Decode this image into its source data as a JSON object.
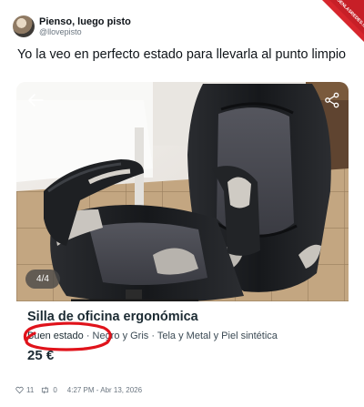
{
  "tweet": {
    "display_name": "Pienso, luego pisto",
    "handle": "@llovepisto",
    "text": "Yo la veo en perfecto estado para llevarla al punto limpio"
  },
  "listing": {
    "image_counter": "4/4",
    "title": "Silla de oficina ergonómica",
    "condition": "Buen estado",
    "attributes": " · Negro y Gris · Tela y Metal y Piel sintética",
    "price": "25 €"
  },
  "footer": {
    "likes": "11",
    "retweets": "0",
    "timestamp": "4:27 PM - Abr 13, 2026"
  },
  "watermark": {
    "text": "VISTOENLASREDES.COM"
  },
  "colors": {
    "annotation_red": "#e0131b",
    "chair_black": "#1d1f22",
    "fabric_gray": "#4a4b52",
    "floor_tile": "#b89a76"
  },
  "icons": [
    "back-arrow-icon",
    "share-icon",
    "heart-icon",
    "retweet-icon",
    "avatar"
  ]
}
